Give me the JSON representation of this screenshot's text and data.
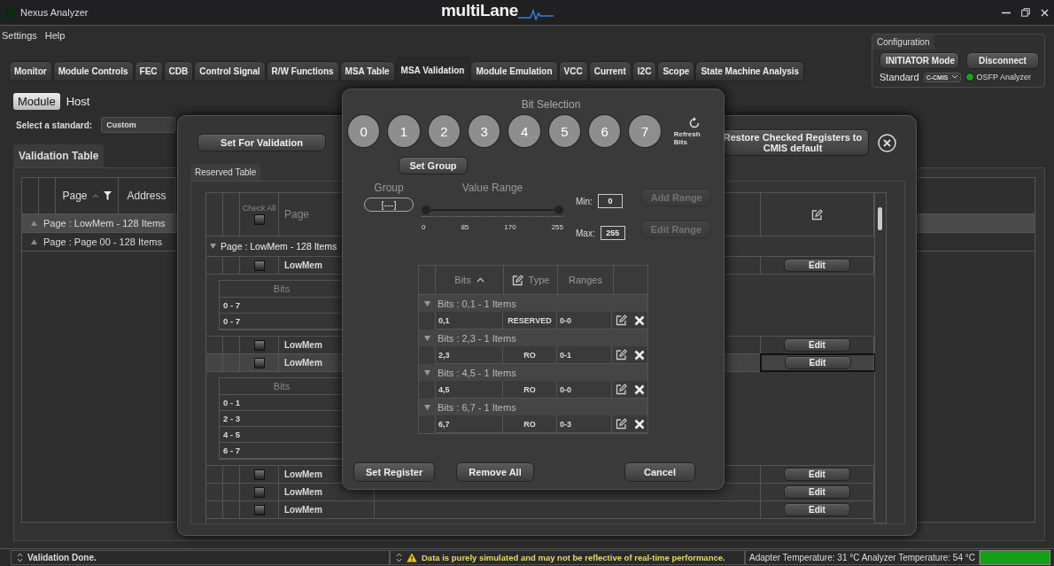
{
  "window": {
    "title": "Nexus Analyzer",
    "logo": "multiLane"
  },
  "menu": [
    "Settings",
    "Help"
  ],
  "tabs": [
    {
      "label": "Monitor",
      "selected": false
    },
    {
      "label": "Module Controls",
      "selected": false
    },
    {
      "label": "FEC",
      "selected": false
    },
    {
      "label": "CDB",
      "selected": false
    },
    {
      "label": "Control Signal",
      "selected": false
    },
    {
      "label": "R/W Functions",
      "selected": false
    },
    {
      "label": "MSA Table",
      "selected": false
    },
    {
      "label": "MSA Validation",
      "selected": true
    },
    {
      "label": "Module Emulation",
      "selected": false
    },
    {
      "label": "VCC",
      "selected": false
    },
    {
      "label": "Current",
      "selected": false
    },
    {
      "label": "I2C",
      "selected": false
    },
    {
      "label": "Scope",
      "selected": false
    },
    {
      "label": "State Machine Analysis",
      "selected": false
    }
  ],
  "configuration": {
    "title": "Configuration",
    "buttons": [
      "INITIATOR Mode",
      "Disconnect"
    ],
    "standard_label": "Standard",
    "standard_value": "C-CMIS",
    "device": "OSFP Analyzer",
    "connected": true
  },
  "side_toggle": [
    {
      "label": "Module",
      "selected": true
    },
    {
      "label": "Host",
      "selected": false
    }
  ],
  "standard_select": {
    "label": "Select a standard:",
    "value": "Custom"
  },
  "validation_table": {
    "title": "Validation Table",
    "columns": [
      "Page",
      "Address"
    ],
    "groups": [
      {
        "label": "Page : LowMem - 128 Items",
        "selected": true
      },
      {
        "label": "Page : Page 00 - 128 Items",
        "selected": false
      }
    ]
  },
  "reserved_dialog": {
    "set_button": "Set For Validation",
    "restore_button": "Restore Checked Registers to CMIS default",
    "tab": "Reserved Table",
    "check_all": "Check All",
    "check_all_checked": false,
    "page_column": "Page",
    "group": "Page : LowMem - 128 Items",
    "rows": [
      {
        "kind": "register",
        "page": "LowMem",
        "checked": false,
        "selected": false,
        "edit": "Edit"
      },
      {
        "kind": "bits",
        "header": "Bits",
        "items": [
          "0 - 7",
          "0 - 7"
        ]
      },
      {
        "kind": "register",
        "page": "LowMem",
        "checked": false,
        "selected": false,
        "edit": "Edit"
      },
      {
        "kind": "register",
        "page": "LowMem",
        "checked": false,
        "selected": true,
        "edit": "Edit"
      },
      {
        "kind": "bits",
        "header": "Bits",
        "items": [
          "0 - 1",
          "2 - 3",
          "4 - 5",
          "6 - 7"
        ]
      },
      {
        "kind": "register",
        "page": "LowMem",
        "checked": false,
        "selected": false,
        "edit": "Edit"
      },
      {
        "kind": "register",
        "page": "LowMem",
        "checked": false,
        "selected": false,
        "edit": "Edit"
      },
      {
        "kind": "register",
        "page": "LowMem",
        "checked": false,
        "selected": false,
        "edit": "Edit"
      }
    ]
  },
  "bit_dialog": {
    "title": "Bit Selection",
    "bits": [
      {
        "label": "0",
        "selected": false
      },
      {
        "label": "1",
        "selected": false
      },
      {
        "label": "2",
        "selected": false
      },
      {
        "label": "3",
        "selected": false
      },
      {
        "label": "4",
        "selected": false
      },
      {
        "label": "5",
        "selected": false
      },
      {
        "label": "6",
        "selected": false
      },
      {
        "label": "7",
        "selected": false
      }
    ],
    "refresh": "Refresh Bits",
    "set_group": "Set Group",
    "group_label": "Group",
    "group_value": "[---]",
    "range_label": "Value Range",
    "level": 1,
    "range_ticks": [
      "0",
      "85",
      "170",
      "255"
    ],
    "min_label": "Min:",
    "min_value": "0",
    "max_label": "Max:",
    "max_value": "255",
    "add_range": "Add Range",
    "edit_range": "Edit Range",
    "ranges_disabled": true,
    "table": {
      "columns": [
        "Bits",
        "Type",
        "Ranges"
      ],
      "groups": [
        {
          "label": "Bits : 0,1 - 1 Items",
          "bits": "0,1",
          "type": "RESERVED",
          "range": "0-0"
        },
        {
          "label": "Bits : 2,3 - 1 Items",
          "bits": "2,3",
          "type": "RO",
          "range": "0-1"
        },
        {
          "label": "Bits : 4,5 - 1 Items",
          "bits": "4,5",
          "type": "RO",
          "range": "0-0"
        },
        {
          "label": "Bits : 6,7 - 1 Items",
          "bits": "6,7",
          "type": "RO",
          "range": "0-3"
        }
      ]
    },
    "footer": [
      "Set Register",
      "Remove All",
      "Cancel"
    ]
  },
  "status": {
    "left": "Validation Done.",
    "warning": "Data is purely simulated and may not be reflective of real-time performance.",
    "temps": "Adapter Temperature: 31 °C  Analyzer Temperature: 54 °C",
    "ok": true
  }
}
